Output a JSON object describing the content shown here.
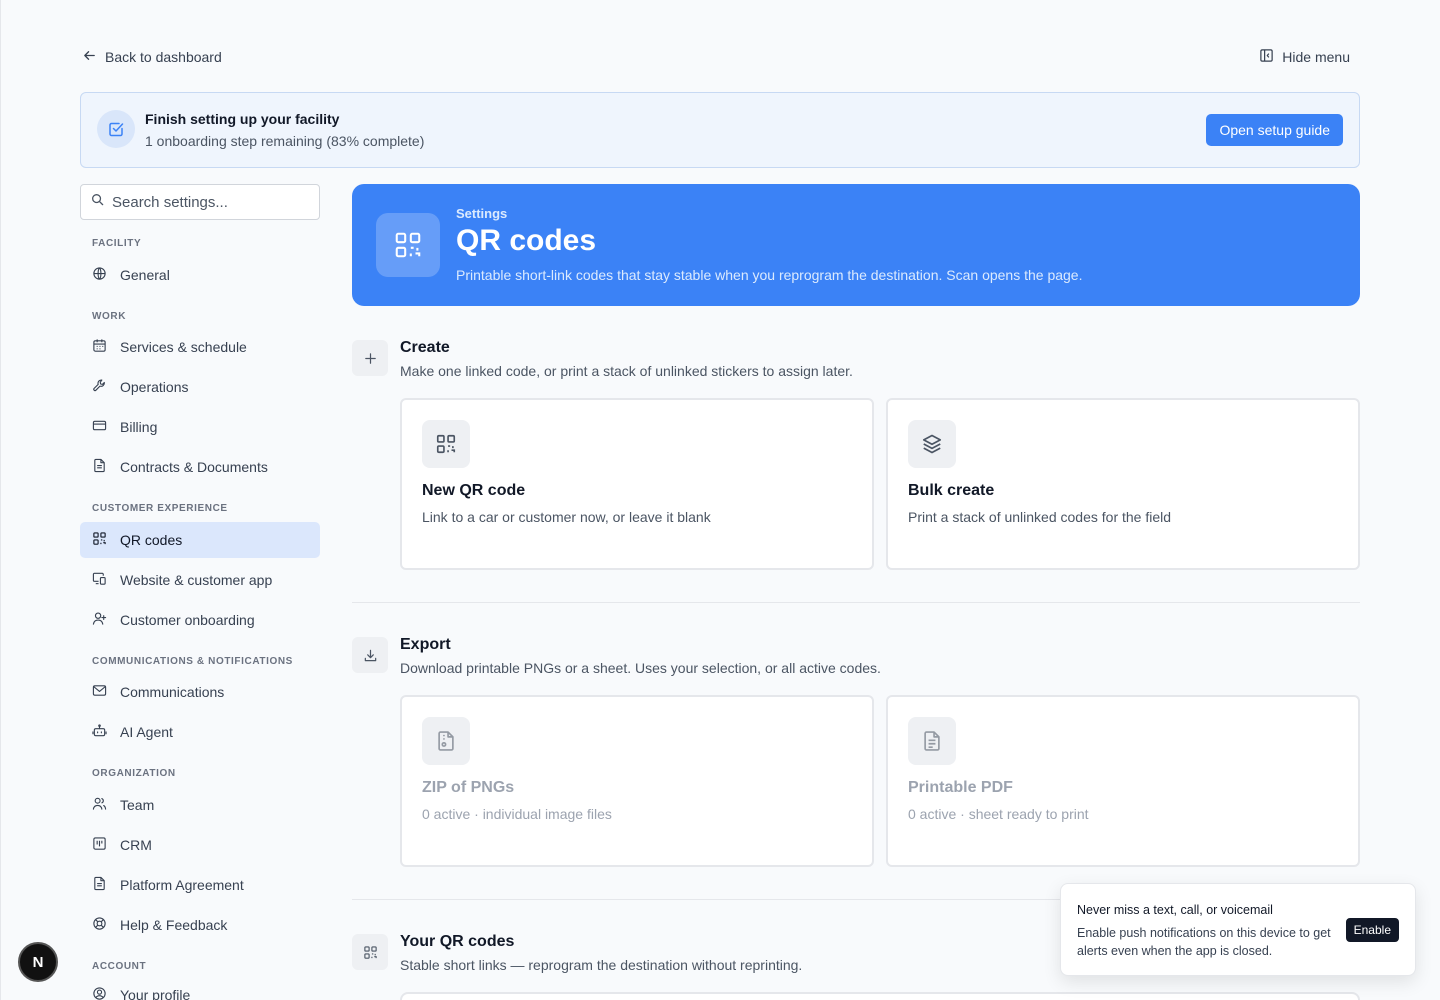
{
  "top": {
    "back_label": "Back to dashboard",
    "hide_label": "Hide menu"
  },
  "banner": {
    "title": "Finish setting up your facility",
    "subtitle": "1 onboarding step remaining (83% complete)",
    "button": "Open setup guide",
    "progress_percent": 83
  },
  "sidebar": {
    "search_placeholder": "Search settings...",
    "sections": {
      "facility": "FACILITY",
      "work": "WORK",
      "cx": "CUSTOMER EXPERIENCE",
      "comms": "COMMUNICATIONS & NOTIFICATIONS",
      "org": "ORGANIZATION",
      "account": "ACCOUNT"
    },
    "items": {
      "general": "General",
      "services": "Services & schedule",
      "operations": "Operations",
      "billing": "Billing",
      "contracts": "Contracts & Documents",
      "qr": "QR codes",
      "website": "Website & customer app",
      "onboarding": "Customer onboarding",
      "communications": "Communications",
      "ai": "AI Agent",
      "team": "Team",
      "crm": "CRM",
      "platform": "Platform Agreement",
      "help": "Help & Feedback",
      "profile": "Your profile"
    },
    "active_item": "QR codes"
  },
  "hero": {
    "eyebrow": "Settings",
    "title": "QR codes",
    "description": "Printable short-link codes that stay stable when you reprogram the destination. Scan opens the page."
  },
  "create": {
    "title": "Create",
    "description": "Make one linked code, or print a stack of unlinked stickers to assign later.",
    "cards": [
      {
        "title": "New QR code",
        "desc": "Link to a car or customer now, or leave it blank"
      },
      {
        "title": "Bulk create",
        "desc": "Print a stack of unlinked codes for the field"
      }
    ]
  },
  "export": {
    "title": "Export",
    "description": "Download printable PNGs or a sheet. Uses your selection, or all active codes.",
    "cards": [
      {
        "title": "ZIP of PNGs",
        "desc": "0 active · individual image files"
      },
      {
        "title": "Printable PDF",
        "desc": "0 active · sheet ready to print"
      }
    ]
  },
  "your_codes": {
    "title": "Your QR codes",
    "description": "Stable short links — reprogram the destination without reprinting."
  },
  "toast": {
    "title": "Never miss a text, call, or voicemail",
    "body": "Enable push notifications on this device to get alerts even when the app is closed.",
    "button": "Enable"
  },
  "avatar": {
    "initial": "N"
  },
  "colors": {
    "accent": "#3b82f6",
    "active_bg": "#dbe7fc",
    "banner_bg": "#eff5fd"
  }
}
